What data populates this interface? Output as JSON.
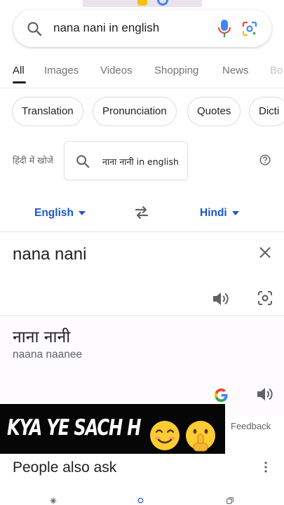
{
  "search": {
    "query": "nana nani in english",
    "search_icon": "search-icon",
    "mic_icon": "mic-icon",
    "lens_icon": "google-lens-icon"
  },
  "tabs": [
    {
      "label": "All",
      "active": true
    },
    {
      "label": "Images",
      "active": false
    },
    {
      "label": "Videos",
      "active": false
    },
    {
      "label": "Shopping",
      "active": false
    },
    {
      "label": "News",
      "active": false
    },
    {
      "label": "Bo",
      "active": false
    }
  ],
  "chips": [
    "Translation",
    "Pronunciation",
    "Quotes",
    "Dicti"
  ],
  "hindi_search": {
    "label": "हिंदी में खोजें",
    "query": "नाना नानी in english",
    "help_icon": "help-icon"
  },
  "translate": {
    "source_lang": "English",
    "target_lang": "Hindi",
    "source_text": "nana nani",
    "target_text": "नाना नानी",
    "transliteration": "naana naanee",
    "icons": [
      "swap-languages-icon",
      "clear-icon",
      "speaker-icon",
      "camera-translate-icon",
      "google-logo-icon"
    ]
  },
  "feedback_label": "Feedback",
  "overlay": {
    "text": "KYA YE SACH H",
    "emojis": [
      "smiling-face-emoji",
      "shushing-face-emoji"
    ]
  },
  "people_also_ask": {
    "title": "People also ask",
    "more_icon": "more-vert-icon"
  },
  "bottom_nav": {
    "icons": [
      "discover-icon",
      "search-icon",
      "tabs-icon"
    ]
  },
  "colors": {
    "accent_blue": "#1a57c7",
    "text_primary": "#202124",
    "text_secondary": "#5f6368",
    "overlay_bg": "#060606"
  }
}
